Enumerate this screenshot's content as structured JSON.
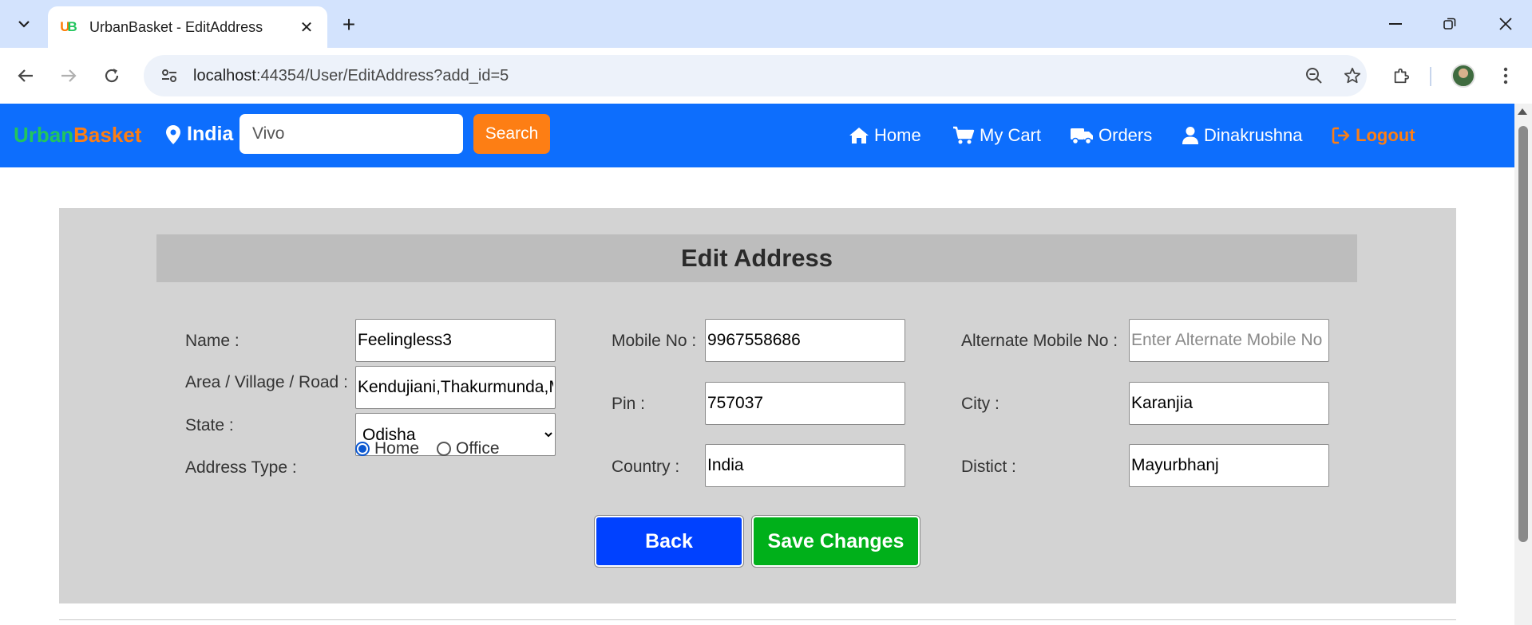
{
  "browser": {
    "tab_title": "UrbanBasket - EditAddress",
    "url_host": "localhost",
    "url_path": ":44354/User/EditAddress?add_id=5"
  },
  "navbar": {
    "brand_part1": "Urban",
    "brand_part2": "Basket",
    "location": "India",
    "search_value": "Vivo",
    "search_button": "Search",
    "links": {
      "home": "Home",
      "cart": "My Cart",
      "orders": "Orders",
      "user": "Dinakrushna",
      "logout": "Logout"
    },
    "colors": {
      "bar": "#0d6efd",
      "accent": "#fd7e14",
      "brand_green": "#22c55e"
    }
  },
  "form": {
    "title": "Edit Address",
    "labels": {
      "name": "Name :",
      "area": "Area / Village / Road :",
      "state": "State :",
      "address_type": "Address Type :",
      "mobile": "Mobile No :",
      "pin": "Pin :",
      "country": "Country :",
      "alt_mobile": "Alternate Mobile No :",
      "city": "City :",
      "district": "Distict :"
    },
    "values": {
      "name": "Feelingless3",
      "area": "Kendujiani,Thakurmunda,M",
      "state": "Odisha",
      "mobile": "9967558686",
      "pin": "757037",
      "country": "India",
      "alt_mobile": "",
      "city": "Karanjia",
      "district": "Mayurbhanj"
    },
    "placeholders": {
      "alt_mobile": "Enter Alternate Mobile No"
    },
    "address_type_options": {
      "home": "Home",
      "office": "Office",
      "selected": "Home"
    },
    "buttons": {
      "back": "Back",
      "save": "Save Changes"
    }
  }
}
